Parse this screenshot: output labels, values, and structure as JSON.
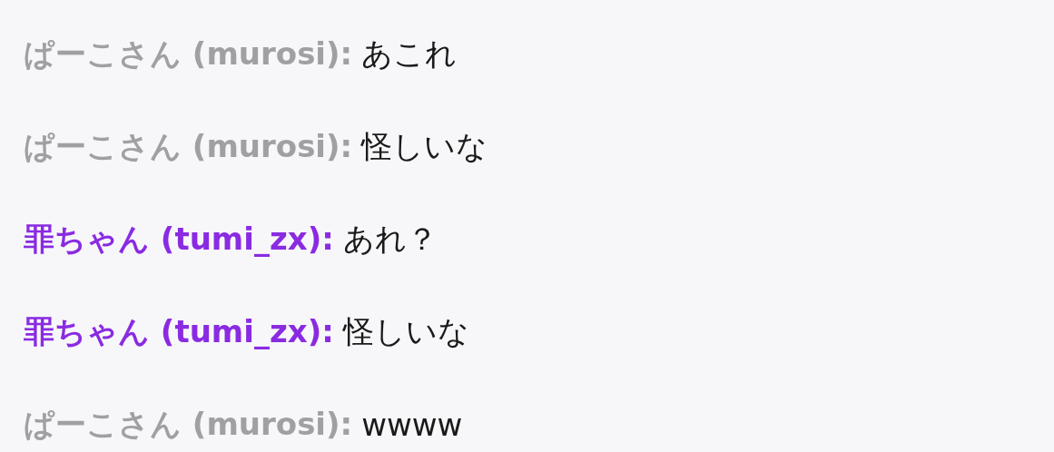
{
  "messages": [
    {
      "author": "ぱーこさん (murosi):",
      "color": "#a0a0a4",
      "text": "あこれ"
    },
    {
      "author": "ぱーこさん (murosi):",
      "color": "#a0a0a4",
      "text": "怪しいな"
    },
    {
      "author": "罪ちゃん (tumi_zx):",
      "color": "#8a2be2",
      "text": "あれ？"
    },
    {
      "author": "罪ちゃん (tumi_zx):",
      "color": "#8a2be2",
      "text": "怪しいな"
    },
    {
      "author": "ぱーこさん (murosi):",
      "color": "#a0a0a4",
      "text": "wwww"
    }
  ]
}
